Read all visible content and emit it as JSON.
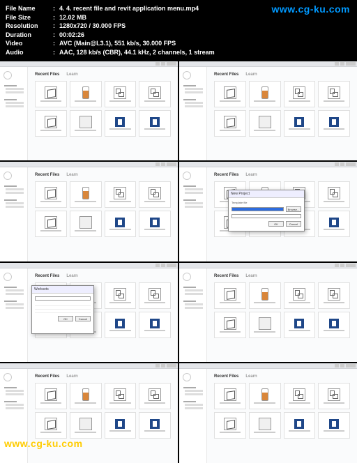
{
  "metadata": {
    "labels": {
      "filename": "File Name",
      "filesize": "File Size",
      "resolution": "Resolution",
      "duration": "Duration",
      "video": "Video",
      "audio": "Audio"
    },
    "filename": "4. 4. recent file and revit application menu.mp4",
    "filesize": "12.02 MB",
    "resolution": "1280x720 / 30.000 FPS",
    "duration": "00:02:26",
    "video": "AVC (Main@L3.1), 551 kb/s, 30.000 FPS",
    "audio": "AAC, 128 kb/s (CBR), 44.1 kHz, 2 channels, 1 stream"
  },
  "watermark": {
    "top": "www.cg-ku.com",
    "bottom": "www.cg-ku.com"
  },
  "revit": {
    "tabs": {
      "recent": "Recent Files",
      "learn": "Learn"
    },
    "dialog_new": {
      "title": "New Project",
      "template_label": "Template file",
      "ok": "OK",
      "cancel": "Cancel",
      "browse": "Browse..."
    },
    "dialog_worksets": {
      "title": "Worksets",
      "ok": "OK",
      "cancel": "Cancel"
    }
  }
}
